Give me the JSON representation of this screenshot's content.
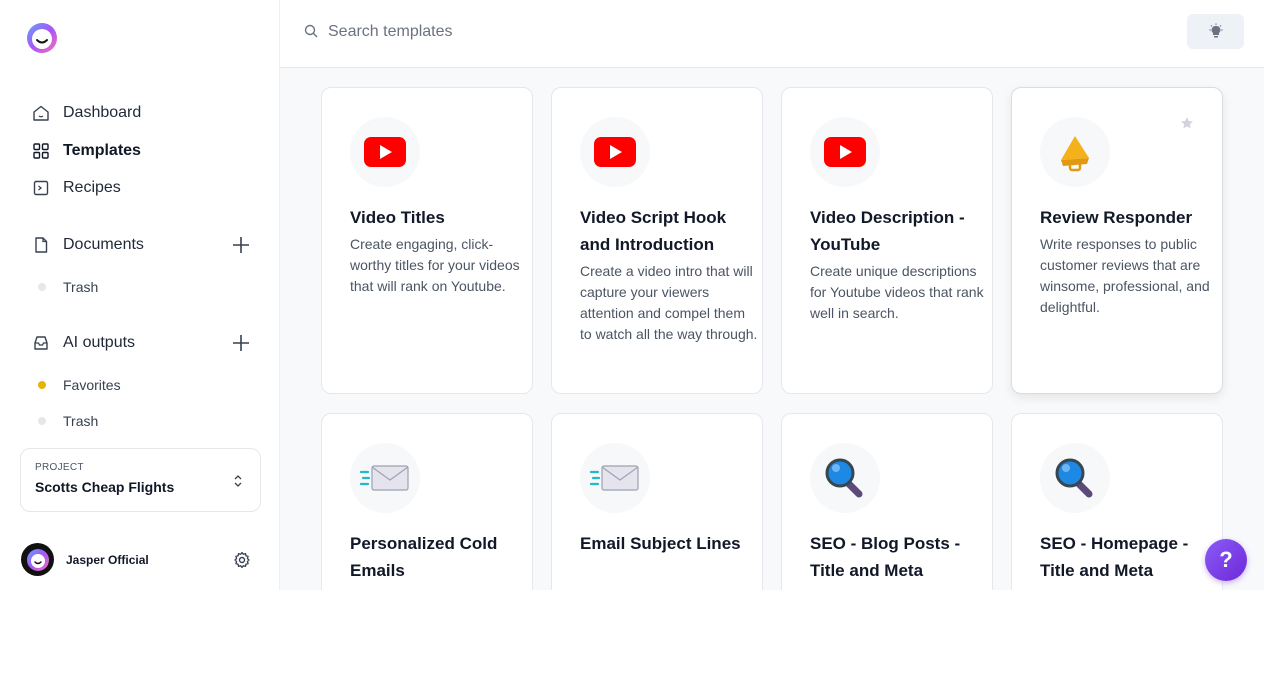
{
  "sidebar": {
    "nav": [
      {
        "label": "Dashboard",
        "icon": "home-icon"
      },
      {
        "label": "Templates",
        "icon": "grid-icon",
        "active": true
      },
      {
        "label": "Recipes",
        "icon": "terminal-icon"
      }
    ],
    "documents": {
      "label": "Documents",
      "icon": "document-icon",
      "trash_label": "Trash"
    },
    "ai_outputs": {
      "label": "AI outputs",
      "icon": "inbox-icon",
      "favorites_label": "Favorites",
      "trash_label": "Trash"
    },
    "project": {
      "label": "PROJECT",
      "value": "Scotts Cheap Flights"
    },
    "user": {
      "name": "Jasper Official"
    }
  },
  "search": {
    "placeholder": "Search templates"
  },
  "cards": [
    {
      "title": "Video Titles",
      "description": "Create engaging, click-worthy titles for your videos that will rank on Youtube.",
      "icon": "youtube-icon"
    },
    {
      "title": "Video Script Hook and Introduction",
      "description": "Create a video intro that will capture your viewers attention and compel them to watch all the way through.",
      "icon": "youtube-icon"
    },
    {
      "title": "Video Description - YouTube",
      "description": "Create unique descriptions for Youtube videos that rank well in search.",
      "icon": "youtube-icon"
    },
    {
      "title": "Review Responder",
      "description": "Write responses to public customer reviews that are winsome, professional, and delightful.",
      "icon": "megaphone-icon"
    },
    {
      "title": "Personalized Cold Emails",
      "description": "",
      "icon": "envelope-icon"
    },
    {
      "title": "Email Subject Lines",
      "description": "",
      "icon": "envelope-icon"
    },
    {
      "title": "SEO - Blog Posts - Title and Meta",
      "description": "",
      "icon": "magnifier-icon"
    },
    {
      "title": "SEO - Homepage - Title and Meta",
      "description": "",
      "icon": "magnifier-icon"
    }
  ],
  "help": {
    "label": "?"
  },
  "colors": {
    "accent": "#7c3aed",
    "youtube": "#ff0000",
    "favorite_dot": "#eab308"
  }
}
